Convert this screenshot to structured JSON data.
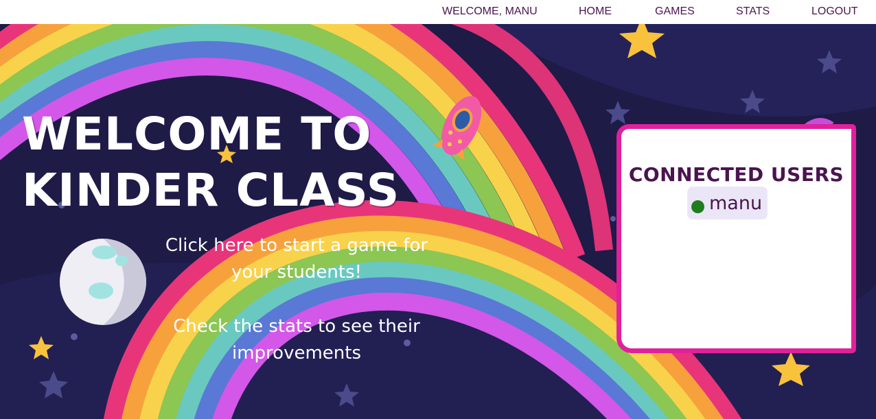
{
  "nav": {
    "welcome_label": "WELCOME, MANU",
    "home_label": "HOME",
    "games_label": "GAMES",
    "stats_label": "STATS",
    "logout_label": "LOGOUT"
  },
  "hero": {
    "title_line1": "Welcome to",
    "title_line2": "Kinder Class",
    "games_cta_line1": "Click here to start a game for",
    "games_cta_line2": "your students!",
    "stats_cta_line1": "Check the stats to see their",
    "stats_cta_line2": "improvements"
  },
  "users_panel": {
    "title": "Connected users",
    "users": [
      {
        "name": "manu",
        "status": "online"
      }
    ]
  },
  "colors": {
    "nav_text": "#4a1450",
    "background": "#1e1b47",
    "panel_border": "#e0219b",
    "online_dot": "#1f7d1f"
  },
  "icons": {
    "moon": "moon-illustration",
    "rocket": "rocket-illustration",
    "stars": "star-icon"
  }
}
